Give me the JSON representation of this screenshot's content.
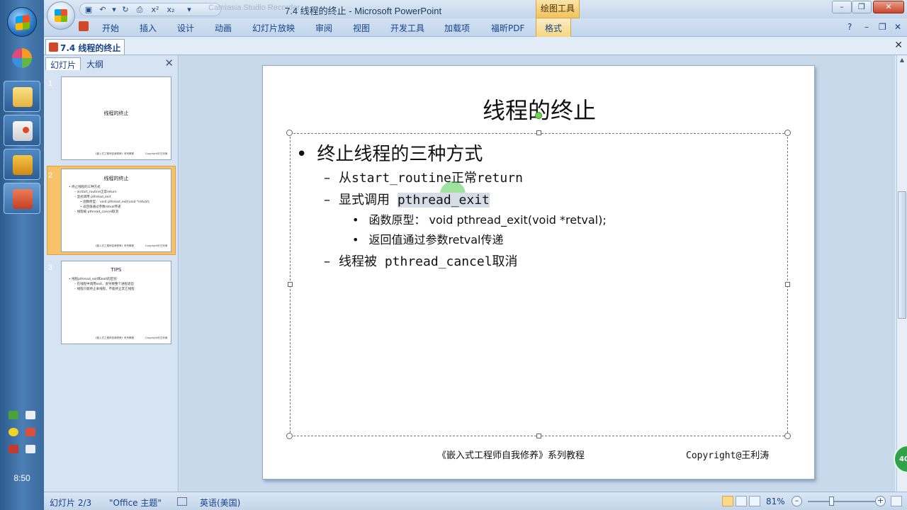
{
  "window": {
    "title": "7.4 线程的终止 - Microsoft PowerPoint",
    "faded_title": "Camtasia Studio Recorder",
    "context_group": "绘图工具"
  },
  "taskbar": {
    "clock": "8:50"
  },
  "ribbon": {
    "tabs": [
      "开始",
      "插入",
      "设计",
      "动画",
      "幻灯片放映",
      "审阅",
      "视图",
      "开发工具",
      "加载项",
      "福昕PDF"
    ],
    "context_tab": "格式"
  },
  "document": {
    "tab_label": "7.4 线程的终止"
  },
  "panel": {
    "tab_slides": "幻灯片",
    "tab_outline": "大纲",
    "thumbs": [
      {
        "num": "1",
        "title": "线程的终止",
        "lines": [],
        "footer_left": "《嵌入式工程师自我修养》系列教程",
        "footer_right": "Copyright@王利涛"
      },
      {
        "num": "2",
        "title": "线程的终止",
        "lines": [
          "• 终止线程的三种方式",
          "– 从start_routine正常return",
          "– 显式调用 pthread_exit",
          "• 函数原型： void pthread_exit(void *retval);",
          "• 返回值通过参数retval传递",
          "– 线程被 pthread_cancel取消"
        ],
        "footer_left": "《嵌入式工程师自我修养》系列教程",
        "footer_right": "Copyright@王利涛"
      },
      {
        "num": "3",
        "title": "TIPS",
        "lines": [
          "• 线程pthread_exit和exit的区别",
          "– 在线程中调用exit，会导致整个进程退出",
          "– 线程只能终止本线程，不能终止其它线程"
        ],
        "footer_left": "《嵌入式工程师自我修养》系列教程",
        "footer_right": "Copyright@王利涛"
      }
    ]
  },
  "slide": {
    "title": "线程的终止",
    "b1": "终止线程的三种方式",
    "b2a": "从start_routine正常return",
    "b2b_pre": "显式调用 ",
    "b2b_hl": "pthread_exit",
    "b3a": "函数原型： void pthread_exit(void *retval);",
    "b3b": "返回值通过参数retval传递",
    "b2c": "线程被 pthread_cancel取消",
    "footer_left": "《嵌入式工程师自我修养》系列教程",
    "footer_right": "Copyright@王利涛"
  },
  "status": {
    "slide_info": "幻灯片 2/3",
    "theme": "\"Office 主题\"",
    "language": "英语(美国)",
    "zoom": "81%",
    "badge": "40"
  },
  "colors": {
    "accent": "#15428b",
    "selection": "#f7c26b"
  }
}
